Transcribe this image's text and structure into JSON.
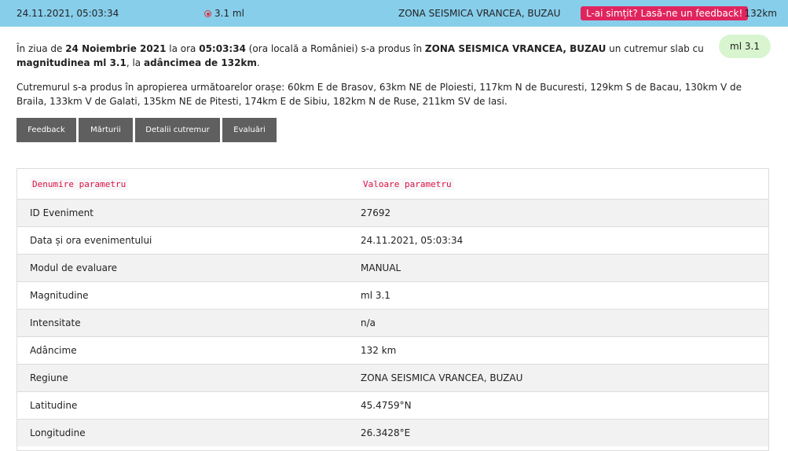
{
  "topbar": {
    "date": "24.11.2021, 05:03:34",
    "magnitude": "3.1 ml",
    "region": "ZONA SEISMICA VRANCEA, BUZAU",
    "feedback_label": "L-ai simțit? Lasă-ne un feedback!",
    "depth": "132km"
  },
  "intro": {
    "p1": "În ziua de ",
    "date": "24 Noiembrie 2021",
    "p2": " la ora ",
    "time": "05:03:34",
    "p3": " (ora locală a României) s-a produs în ",
    "region": "ZONA SEISMICA VRANCEA, BUZAU",
    "p4": " un cutremur slab cu ",
    "mag_phrase": "magnitudinea ml 3.1",
    "p5": ", la ",
    "depth_phrase": "adâncimea de 132km",
    "p6": "."
  },
  "badge": "ml 3.1",
  "cities": "Cutremurul s-a produs în apropierea următoarelor orașe: 60km E de Brasov, 63km NE de Ploiesti, 117km N de Bucuresti, 129km S de Bacau, 130km V de Braila, 133km V de Galati, 135km NE de Pitesti, 174km E de Sibiu, 182km N de Ruse, 211km SV de Iasi.",
  "buttons": {
    "feedback": "Feedback",
    "marturii": "Mărturii",
    "detalii": "Detalii cutremur",
    "evaluari": "Evaluări"
  },
  "table": {
    "header": {
      "name": "Denumire parametru",
      "value": "Valoare parametru"
    },
    "rows": [
      {
        "name": "ID Eveniment",
        "value": "27692"
      },
      {
        "name": "Data și ora evenimentului",
        "value": "24.11.2021, 05:03:34"
      },
      {
        "name": "Modul de evaluare",
        "value": "MANUAL"
      },
      {
        "name": "Magnitudine",
        "value": "ml 3.1"
      },
      {
        "name": "Intensitate",
        "value": "n/a"
      },
      {
        "name": "Adâncime",
        "value": "132 km"
      },
      {
        "name": "Regiune",
        "value": "ZONA SEISMICA VRANCEA, BUZAU"
      },
      {
        "name": "Latitudine",
        "value": "45.4759°N"
      },
      {
        "name": "Longitudine",
        "value": "26.3428°E"
      }
    ]
  }
}
